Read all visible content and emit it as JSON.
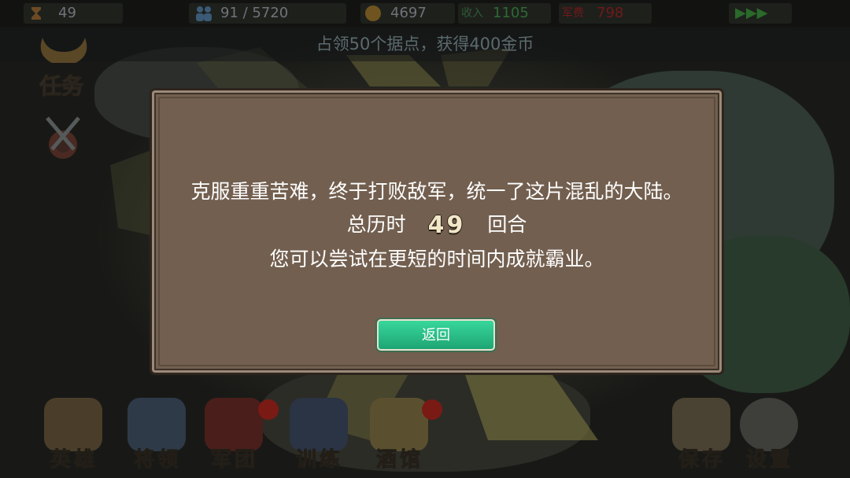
{
  "status_bar": {
    "turn": "49",
    "population": "91 / 5720",
    "gold": "4697",
    "income_label": "收入",
    "income_value": "1105",
    "upkeep_label": "军费",
    "upkeep_value": "798",
    "speed": "▶▶▶"
  },
  "notice": "占领50个据点，获得400金币",
  "sidebar": {
    "quest_label": "任务"
  },
  "dialog": {
    "line1": "克服重重苦难，终于打败敌军，统一了这片混乱的大陆。",
    "turns_prefix": "总历时",
    "turns_value": "49",
    "turns_suffix": "回合",
    "line3": "您可以尝试在更短的时间内成就霸业。",
    "button": "返回"
  },
  "bottom_menu": [
    {
      "label": "英雄"
    },
    {
      "label": "将领"
    },
    {
      "label": "军团"
    },
    {
      "label": "训练"
    },
    {
      "label": "酒馆"
    },
    {
      "label": "保存"
    },
    {
      "label": "设置"
    }
  ],
  "colors": {
    "dialog_bg": "#725f4f",
    "button_green": "#2cc489",
    "income_green": "#2e6a34",
    "upkeep_red": "#6e1a1a"
  }
}
